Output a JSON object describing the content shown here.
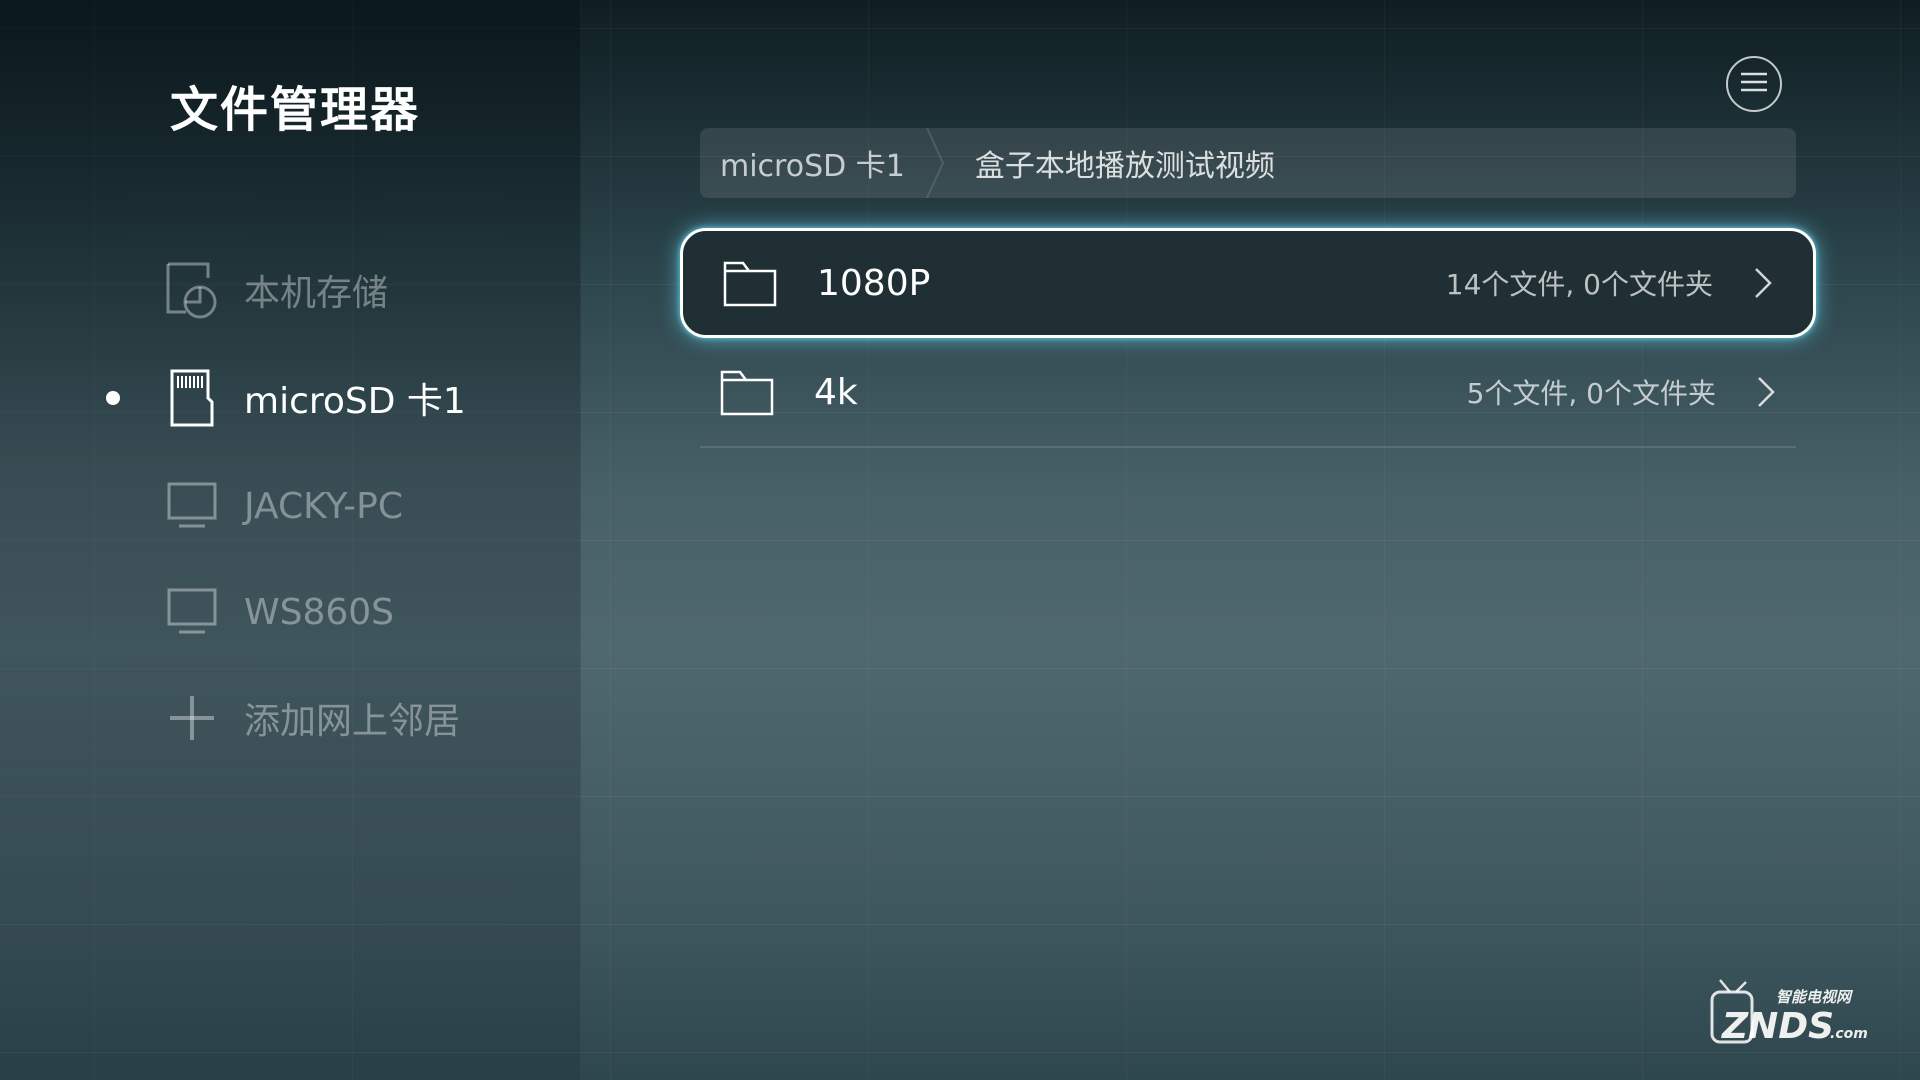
{
  "app": {
    "title": "文件管理器"
  },
  "sidebar": {
    "items": [
      {
        "label": "本机存储",
        "icon": "local-storage-icon",
        "active": false
      },
      {
        "label": "microSD 卡1",
        "icon": "sd-card-icon",
        "active": true
      },
      {
        "label": "JACKY-PC",
        "icon": "monitor-icon",
        "active": false
      },
      {
        "label": "WS860S",
        "icon": "monitor-icon",
        "active": false
      },
      {
        "label": "添加网上邻居",
        "icon": "plus-icon",
        "active": false
      }
    ]
  },
  "header": {
    "menu_icon": "hamburger-menu-icon"
  },
  "breadcrumb": {
    "items": [
      "microSD 卡1",
      "盒子本地播放测试视频"
    ]
  },
  "files": [
    {
      "name": "1080P",
      "info": "14个文件, 0个文件夹",
      "icon": "folder-icon",
      "selected": true
    },
    {
      "name": "4k",
      "info": "5个文件, 0个文件夹",
      "icon": "folder-icon",
      "selected": false
    }
  ],
  "watermark": {
    "top_text": "智能电视网",
    "main_text": "ZNDS",
    "suffix": ".com"
  },
  "colors": {
    "focus_glow": "#5ac8e6",
    "selected_row_bg": "#1f2f33",
    "text_dim": "rgba(255,255,255,0.38)"
  }
}
